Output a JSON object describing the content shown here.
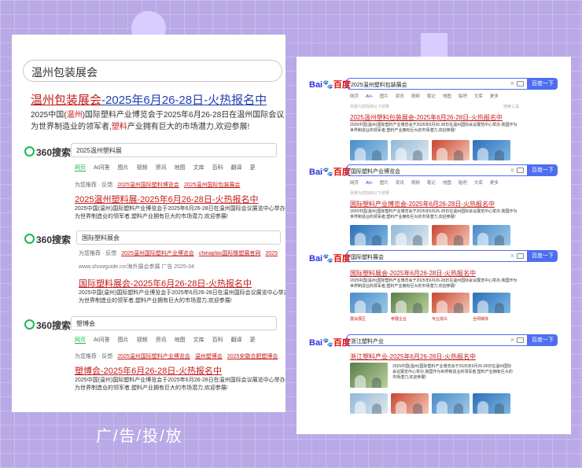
{
  "caption": "广/告/投/放",
  "left": {
    "query": "温州包装展会",
    "ad_title_a": "温州包装展会",
    "ad_title_b": "-2025年6月26-28日-火热报名中",
    "ad_desc_1a": "2025中国(",
    "ad_desc_1b": "温州",
    "ad_desc_1c": ")国际塑料产业博览会于2025年6月26-28日在温州国际会议",
    "ad_desc_2a": "为世界制造业的领军者,",
    "ad_desc_2b": "塑料",
    "ad_desc_2c": "产业拥有巨大的市场潜力,欢迎参展!",
    "logo": "360搜索",
    "tabs": [
      "网页",
      "AI问答",
      "图片",
      "视频",
      "资讯",
      "地图",
      "文库",
      "百科",
      "翻译",
      "更"
    ],
    "rec_label": "为您推荐 · 反馈",
    "blocks": [
      {
        "query": "2025温州塑料展",
        "recs": [
          "2025温州国际塑料博览会",
          "2025温州国际包装展会"
        ],
        "title": "2025温州塑料展-2025年6月26-28日-火热报名中",
        "desc1": "2025中国(温州)国际塑料产业博览会于2025年6月26-28日在温州国际会议展览中心举办,我国作",
        "desc2": "为世界制造业的领军者,塑料产业拥有巨大的市场潜力,欢迎参展!"
      },
      {
        "query": "国际塑料展会",
        "recs": [
          "2025温州国际塑料产业博览会",
          "chinaplas国际橡塑展官网",
          "2025"
        ],
        "source": "www.showguide.cn/海外展会参展 广告 2025-04",
        "title": "国际塑料展会-2025年6月26-28日-火热报名中",
        "desc1": "2025中国(温州)国际塑料产业博览会于2025年6月26-28日在温州国际会议展览中心举办,我国作",
        "desc2": "为世界制造业的领军者,塑料产业拥有巨大的市场潜力,欢迎参展!"
      },
      {
        "query": "塑博会",
        "recs": [
          "2025温州国际塑料产业博览会",
          "温州塑博会",
          "2025安徽合肥塑博会"
        ],
        "title": "塑博会-2025年6月26-28日-火热报名中",
        "desc1": "2025中国(温州)国际塑料产业博览会于2025年6月26-28日在温州国际会议展览中心举办,我国作",
        "desc2": "为世界制造业的领军者,塑料产业拥有巨大的市场潜力,欢迎参展!"
      }
    ]
  },
  "right": {
    "logo_a": "Bai",
    "logo_b": "百度",
    "search_btn": "百度一下",
    "tabs": [
      "网页",
      "AI+",
      "图片",
      "资讯",
      "视频",
      "笔记",
      "地图",
      "贴吧",
      "文库",
      "更多"
    ],
    "meta": "百度为您找到以下结果",
    "tool": "搜索工具",
    "blocks": [
      {
        "query": "2025温州塑料包装展会",
        "title": "2025温州塑料包装展会-2025年6月26-28日-火热报名中",
        "desc1": "2025中国(温州)国际塑料产业博览会于2025年6月26-28日在温州国际会议展览中心举办,我国作为",
        "desc2": "世界制造业的领军者,塑料产业拥有巨大的市场潜力,欢迎参展!"
      },
      {
        "query": "国际塑料产业博览会",
        "title": "国际塑料产业博览会-2025年6月26-28日-火热报名中",
        "desc1": "2025中国(温州)国际塑料产业博览会于2025年6月26-28日在温州国际会议展览中心举办,我国作为",
        "desc2": "世界制造业的领军者,塑料产业拥有巨大的市场潜力,欢迎参展!"
      },
      {
        "query": "国际塑料展会",
        "title": "国际塑料展会-2025年6月26-28日-火热报名中",
        "desc1": "2025中国(温州)国际塑料产业博览会于2025年6月26-28日在温州国际会议展览中心举办,我国作为",
        "desc2": "世界制造业的领军者,塑料产业拥有巨大的市场潜力,欢迎参展!",
        "captions": [
          "展会展区",
          "参展企业",
          "专业观众",
          "全网媒体"
        ]
      },
      {
        "query": "浙江塑料产业",
        "title": "浙江塑料产业-2025年6月26-28日-火热报名中",
        "desc1": "2025中国(温州)国际塑料产业博览会于2025年6月26-28日在温州国际",
        "desc2": "会议展览中心举办,我国作为世界制造业的领军者,塑料产业拥有巨大的",
        "desc3": "市场潜力,欢迎参展!"
      }
    ]
  }
}
